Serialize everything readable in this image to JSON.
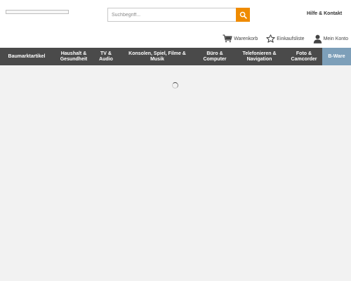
{
  "search": {
    "placeholder": "Suchbegriff..."
  },
  "header": {
    "help_label": "Hilfe & Kontakt"
  },
  "account": {
    "cart_label": "Warenkorb",
    "wishlist_label": "Einkaufsliste",
    "profile_label": "Mein Konto"
  },
  "nav": {
    "items": [
      {
        "line1": "Baumarktartikel",
        "line2": ""
      },
      {
        "line1": "Haushalt &",
        "line2": "Gesundheit"
      },
      {
        "line1": "TV &",
        "line2": "Audio"
      },
      {
        "line1": "Konsolen, Spiel, Filme &",
        "line2": "Musik"
      },
      {
        "line1": "Büro &",
        "line2": "Computer"
      },
      {
        "line1": "Telefonieren &",
        "line2": "Navigation"
      },
      {
        "line1": "Foto &",
        "line2": "Camcorder"
      },
      {
        "line1": "B-Ware",
        "line2": ""
      }
    ]
  },
  "colors": {
    "accent": "#ef8b00",
    "nav_background": "#4a4a4a",
    "nav_highlight": "#7d9fb9",
    "page_background": "#f2f2f2"
  }
}
